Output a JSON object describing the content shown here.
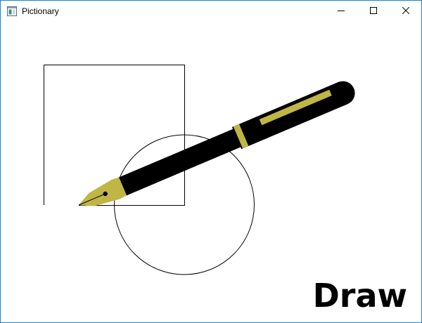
{
  "window": {
    "title": "Pictionary"
  },
  "icons": {
    "app": "window-app-icon",
    "minimize": "minimize-icon",
    "maximize": "maximize-icon",
    "close": "close-icon",
    "pen": "fountain-pen-icon"
  },
  "canvas": {
    "shapes": [
      "square",
      "circle"
    ],
    "stroke_color": "#000000"
  },
  "pen": {
    "body_color": "#000000",
    "accent_color": "#c0b645",
    "nib_color": "#c0b645",
    "nib_tip_color": "#d4d4d4"
  },
  "draw_label": "Draw"
}
